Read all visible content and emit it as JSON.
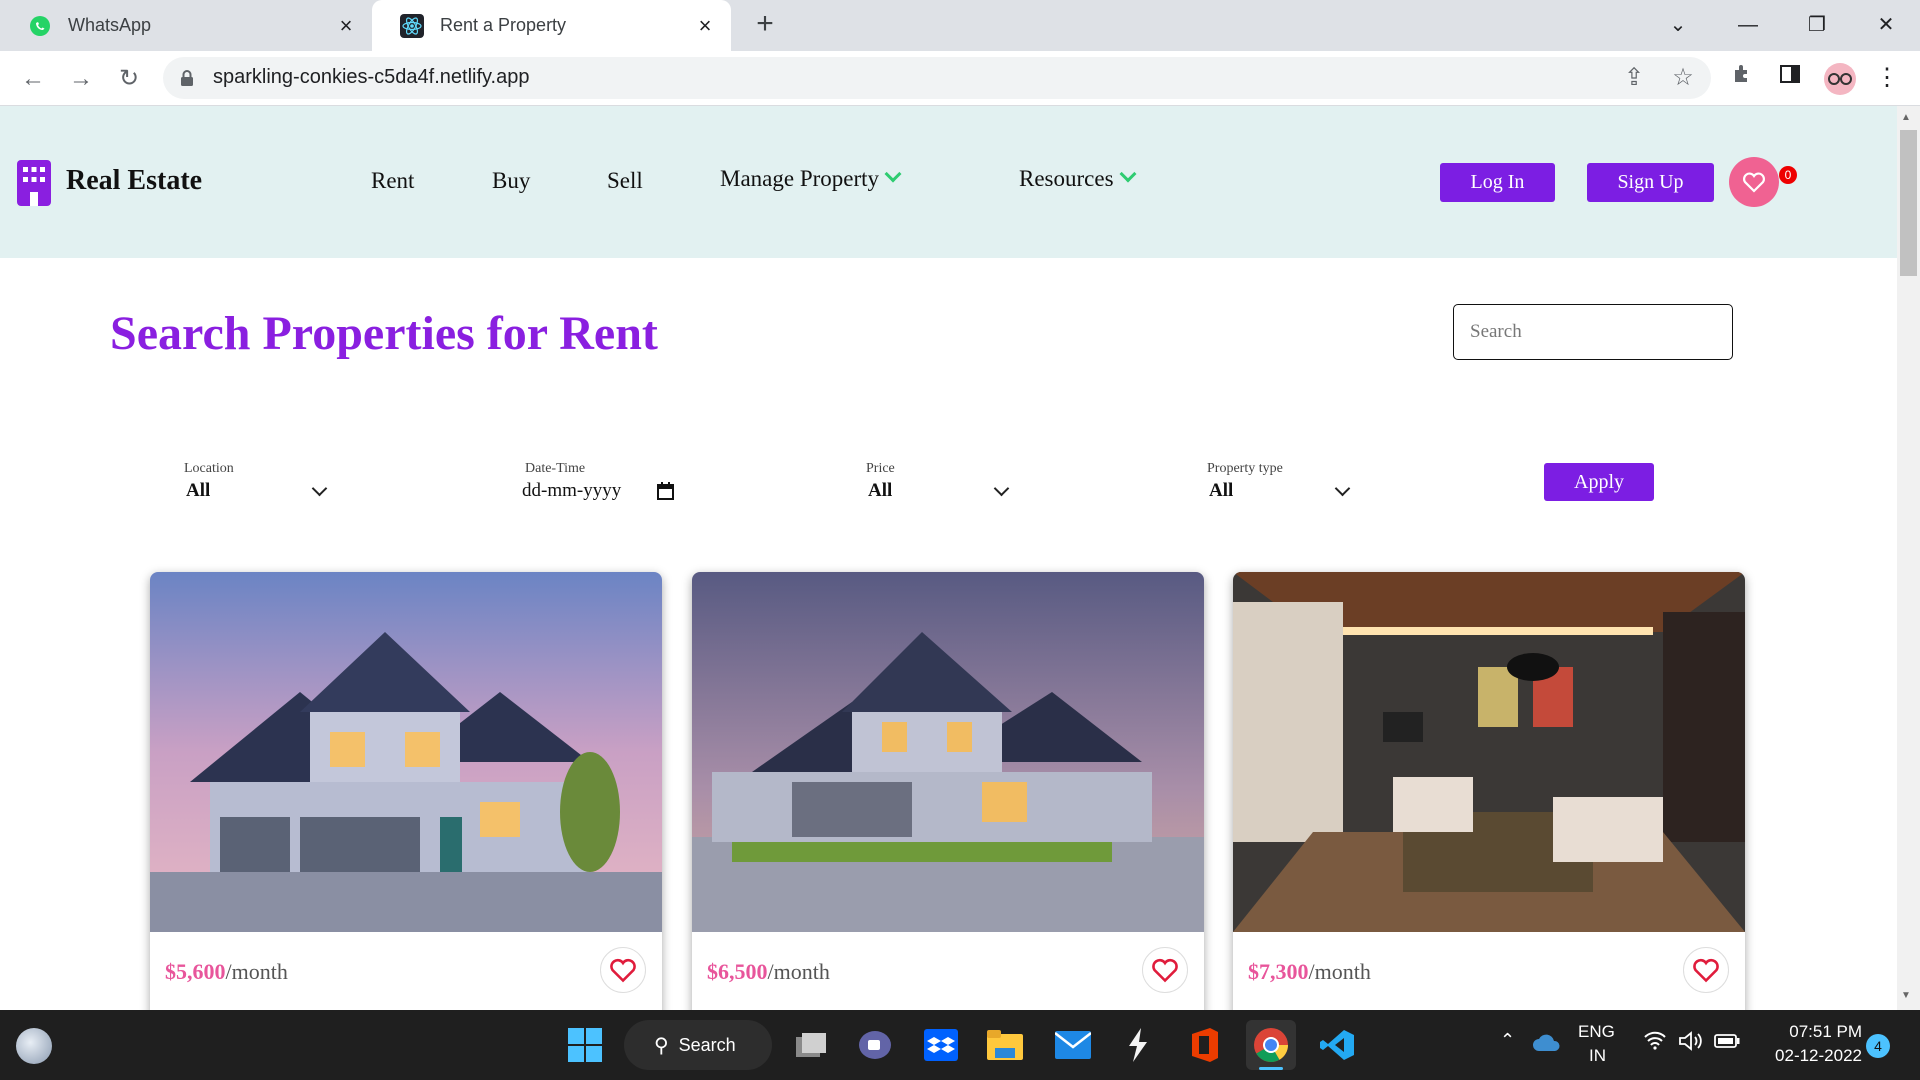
{
  "browser": {
    "tabs": [
      {
        "label": "WhatsApp",
        "icon": "whatsapp-icon",
        "active": false
      },
      {
        "label": "Rent a Property",
        "icon": "react-icon",
        "active": true
      }
    ],
    "url": "sparkling-conkies-c5da4f.netlify.app"
  },
  "site": {
    "brand": "Real Estate",
    "nav": [
      "Rent",
      "Buy",
      "Sell",
      "Manage Property",
      "Resources"
    ],
    "login_label": "Log In",
    "signup_label": "Sign Up",
    "favorites_count": "0",
    "accent_color": "#7c1ee3"
  },
  "main": {
    "title": "Search Properties for Rent",
    "search_placeholder": "Search"
  },
  "filters": {
    "location": {
      "label": "Location",
      "value": "All"
    },
    "datetime": {
      "label": "Date-Time",
      "value": "dd-mm-yyyy"
    },
    "price": {
      "label": "Price",
      "value": "All"
    },
    "property_type": {
      "label": "Property type",
      "value": "All"
    },
    "apply_label": "Apply"
  },
  "listings": [
    {
      "price": "$5,600",
      "unit": "/month",
      "image": "house-exterior-dusk"
    },
    {
      "price": "$6,500",
      "unit": "/month",
      "image": "house-exterior-street"
    },
    {
      "price": "$7,300",
      "unit": "/month",
      "image": "living-room-interior"
    }
  ],
  "taskbar": {
    "search_label": "Search",
    "lang": "ENG",
    "region": "IN",
    "time": "07:51 PM",
    "date": "02-12-2022",
    "notifications": "4"
  }
}
